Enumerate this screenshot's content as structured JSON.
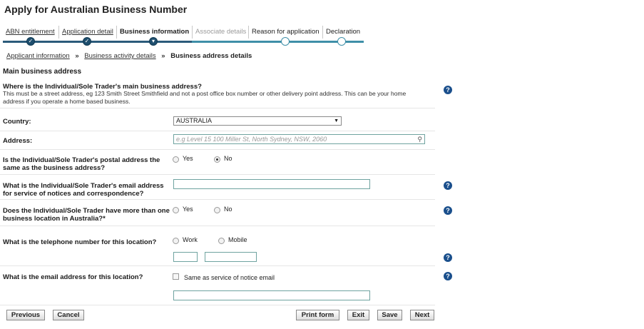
{
  "page": {
    "title": "Apply for Australian Business Number"
  },
  "steps": [
    {
      "label": "ABN entitlement",
      "state": "done"
    },
    {
      "label": "Application detail",
      "state": "done"
    },
    {
      "label": "Business information",
      "state": "current"
    },
    {
      "label": "Associate details",
      "state": "disabled"
    },
    {
      "label": "Reason for application",
      "state": "todo"
    },
    {
      "label": "Declaration",
      "state": "todo"
    }
  ],
  "breadcrumb": {
    "items": [
      "Applicant information",
      "Business activity details",
      "Business address details"
    ],
    "separator": "»"
  },
  "section": {
    "title": "Main business address"
  },
  "main_address": {
    "question": "Where is the Individual/Sole Trader's main business address?",
    "desc_line1": "This must be a street address, eg 123 Smith Street Smithfield and not a post office box number or other delivery point address. This can be your home",
    "desc_line2": "address if you operate a home based business."
  },
  "country": {
    "label": "Country:",
    "value": "AUSTRALIA"
  },
  "address": {
    "label": "Address:",
    "placeholder": "e.g Level 15 100 Miller St, North Sydney, NSW, 2060"
  },
  "postal_same": {
    "line1": "Is the Individual/Sole Trader's postal address the",
    "line2": "same as the business address?",
    "yes": "Yes",
    "no": "No",
    "selected": "No"
  },
  "email_service": {
    "line1": "What is the Individual/Sole Trader's email address",
    "line2": "for service of notices and correspondence?",
    "value": ""
  },
  "more_locations": {
    "line1": "Does the Individual/Sole Trader have more than one",
    "line2": "business location in Australia?*",
    "yes": "Yes",
    "no": "No",
    "selected": ""
  },
  "telephone": {
    "label": "What is the telephone number for this location?",
    "work": "Work",
    "mobile": "Mobile",
    "selected": "",
    "area_code": "",
    "number": ""
  },
  "location_email": {
    "label": "What is the email address for this location?",
    "same_label": "Same as service of notice email",
    "same_checked": false,
    "value": ""
  },
  "buttons": {
    "previous": "Previous",
    "cancel": "Cancel",
    "print": "Print form",
    "exit": "Exit",
    "save": "Save",
    "next": "Next"
  },
  "help_icon_glyph": "?",
  "search_icon_glyph": "⚲",
  "colors": {
    "step_done": "#2b5b7b",
    "step_todo": "#3f8fa8",
    "help": "#1a4f8c",
    "input_border": "#6fa3a0"
  }
}
